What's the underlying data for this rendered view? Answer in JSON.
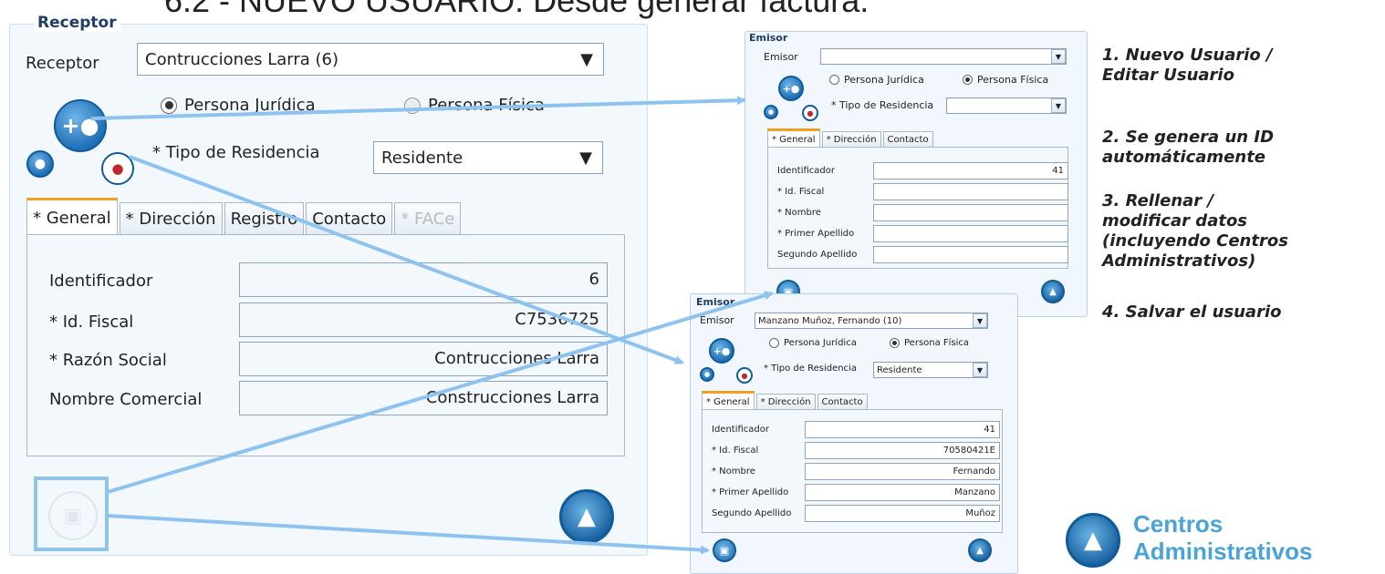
{
  "slide_title": "6.2 - NUEVO USUARIO. Desde generar factura.",
  "main_panel": {
    "title": "Receptor",
    "receptor_label": "Receptor",
    "receptor_value": "Contrucciones Larra (6)",
    "radio_juridica": "Persona Jurídica",
    "radio_fisica": "Persona Física",
    "residencia_label": "* Tipo de Residencia",
    "residencia_value": "Residente",
    "tabs": [
      "* General",
      "* Dirección",
      "Registro",
      "Contacto",
      "* FACe"
    ],
    "fields": [
      {
        "label": "Identificador",
        "value": "6"
      },
      {
        "label": "* Id. Fiscal",
        "value": "C7536725"
      },
      {
        "label": "* Razón Social",
        "value": "Contrucciones Larra"
      },
      {
        "label": "Nombre Comercial",
        "value": "Construcciones Larra"
      }
    ]
  },
  "emisor_empty": {
    "title": "Emisor",
    "emisor_label": "Emisor",
    "emisor_value": "",
    "radio_juridica": "Persona Jurídica",
    "radio_fisica": "Persona Física",
    "residencia_label": "* Tipo de Residencia",
    "residencia_value": "",
    "tabs": [
      "* General",
      "* Dirección",
      "Contacto"
    ],
    "fields": [
      {
        "label": "Identificador",
        "value": "41"
      },
      {
        "label": "* Id. Fiscal",
        "value": ""
      },
      {
        "label": "* Nombre",
        "value": ""
      },
      {
        "label": "* Primer Apellido",
        "value": ""
      },
      {
        "label": "Segundo Apellido",
        "value": ""
      }
    ]
  },
  "emisor_filled": {
    "title": "Emisor",
    "emisor_label": "Emisor",
    "emisor_value": "Manzano Muñoz, Fernando (10)",
    "radio_juridica": "Persona Jurídica",
    "radio_fisica": "Persona Física",
    "residencia_label": "* Tipo de Residencia",
    "residencia_value": "Residente",
    "tabs": [
      "* General",
      "* Dirección",
      "Contacto"
    ],
    "fields": [
      {
        "label": "Identificador",
        "value": "41"
      },
      {
        "label": "* Id. Fiscal",
        "value": "70580421E"
      },
      {
        "label": "* Nombre",
        "value": "Fernando"
      },
      {
        "label": "* Primer Apellido",
        "value": "Manzano"
      },
      {
        "label": "Segundo Apellido",
        "value": "Muñoz"
      }
    ]
  },
  "instructions": [
    [
      "1. Nuevo Usuario /",
      "Editar Usuario"
    ],
    [
      "2. Se genera un ID",
      "automáticamente"
    ],
    [
      "3. Rellenar /",
      "modificar datos",
      "(incluyendo Centros",
      "Administrativos)"
    ],
    [
      "4. Salvar el usuario"
    ]
  ],
  "centros": [
    "Centros",
    "Administrativos"
  ],
  "colors": {
    "accent_blue": "#1f6fb4",
    "arrow": "#8ec3f0",
    "tab_active_top": "#f0a020",
    "centros_text": "#4aa3d8"
  }
}
